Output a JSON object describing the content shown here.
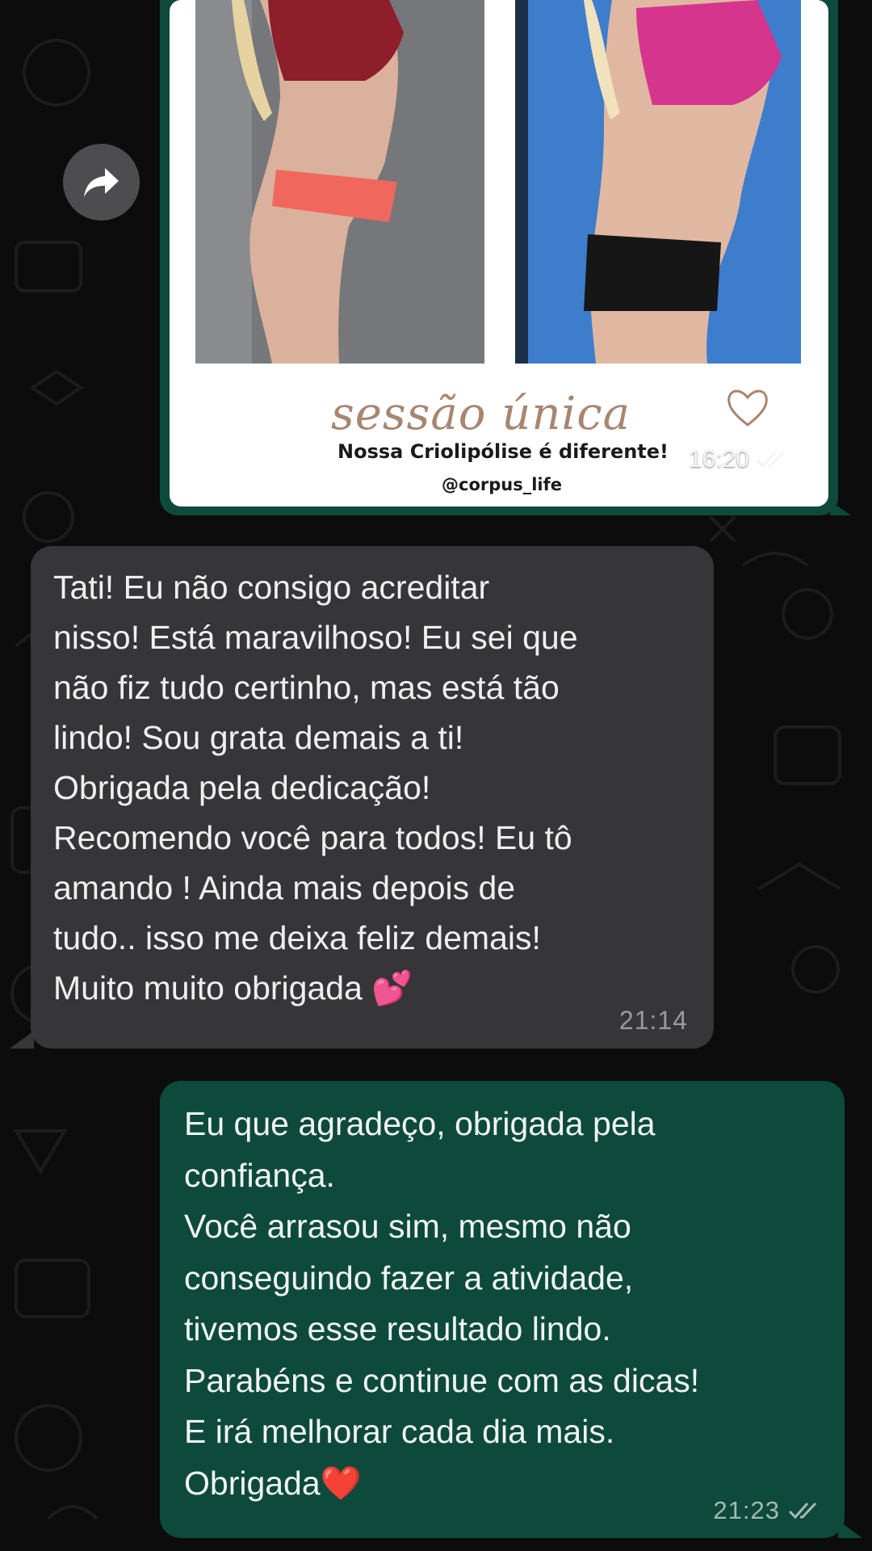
{
  "forward_icon": "forward-arrow-icon",
  "image_message": {
    "caption_title": "sessão única",
    "caption_subtitle": "Nossa Criolipólise é diferente!",
    "caption_handle": "@corpus_life",
    "time": "16:20",
    "status_icon": "double-check-icon"
  },
  "incoming_message": {
    "lines": [
      "Tati! Eu não consigo acreditar",
      "nisso! Está maravilhoso! Eu sei que",
      "não fiz tudo certinho, mas está tão",
      "lindo! Sou grata demais a ti!",
      "Obrigada pela dedicação!",
      "Recomendo você para todos! Eu tô",
      "amando ! Ainda mais depois de",
      "tudo.. isso me deixa feliz demais!",
      "Muito muito obrigada"
    ],
    "emoji": "💕",
    "time": "21:14"
  },
  "outgoing_message": {
    "lines": [
      "Eu que agradeço, obrigada pela",
      "confiança.",
      "Você arrasou sim, mesmo não",
      "conseguindo fazer a atividade,",
      "tivemos esse resultado lindo.",
      "Parabéns e continue com as dicas!",
      "E irá melhorar cada dia mais.",
      "Obrigada"
    ],
    "emoji": "❤️",
    "time": "21:23",
    "status_icon": "double-check-icon"
  },
  "colors": {
    "background": "#0c0c0c",
    "incoming_bubble": "#363638",
    "outgoing_bubble": "#0d4a3c",
    "caption_script": "#a78672"
  }
}
